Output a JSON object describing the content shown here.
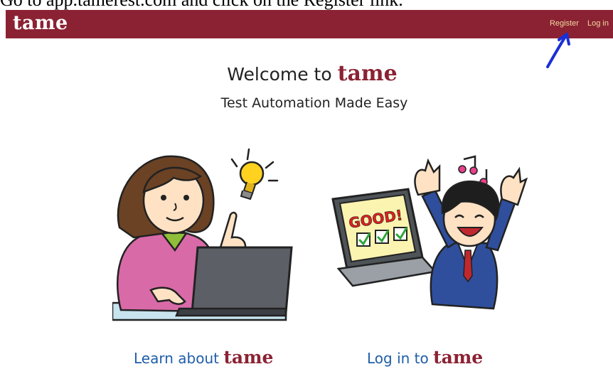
{
  "instruction": {
    "text": "Go to app.tamerest.com and click on the Register link."
  },
  "navbar": {
    "brand": "tame",
    "links": [
      {
        "label": "Register"
      },
      {
        "label": "Log in"
      }
    ],
    "bg_color": "#8b2233",
    "link_color": "#f3d9a0"
  },
  "annotation": {
    "arrow_color": "#1a2fd6",
    "icon": "hand-drawn-arrow-icon"
  },
  "hero": {
    "title_prefix": "Welcome to",
    "brand": "tame",
    "subtitle": "Test Automation Made Easy"
  },
  "illustrations": {
    "left": {
      "icon": "woman-at-laptop-with-idea-icon"
    },
    "right": {
      "icon": "man-celebrating-good-results-icon",
      "laptop_text": "GOOD!"
    }
  },
  "links": {
    "learn": {
      "prefix": "Learn about",
      "brand": "tame"
    },
    "login": {
      "prefix": "Log in to",
      "brand": "tame"
    }
  }
}
